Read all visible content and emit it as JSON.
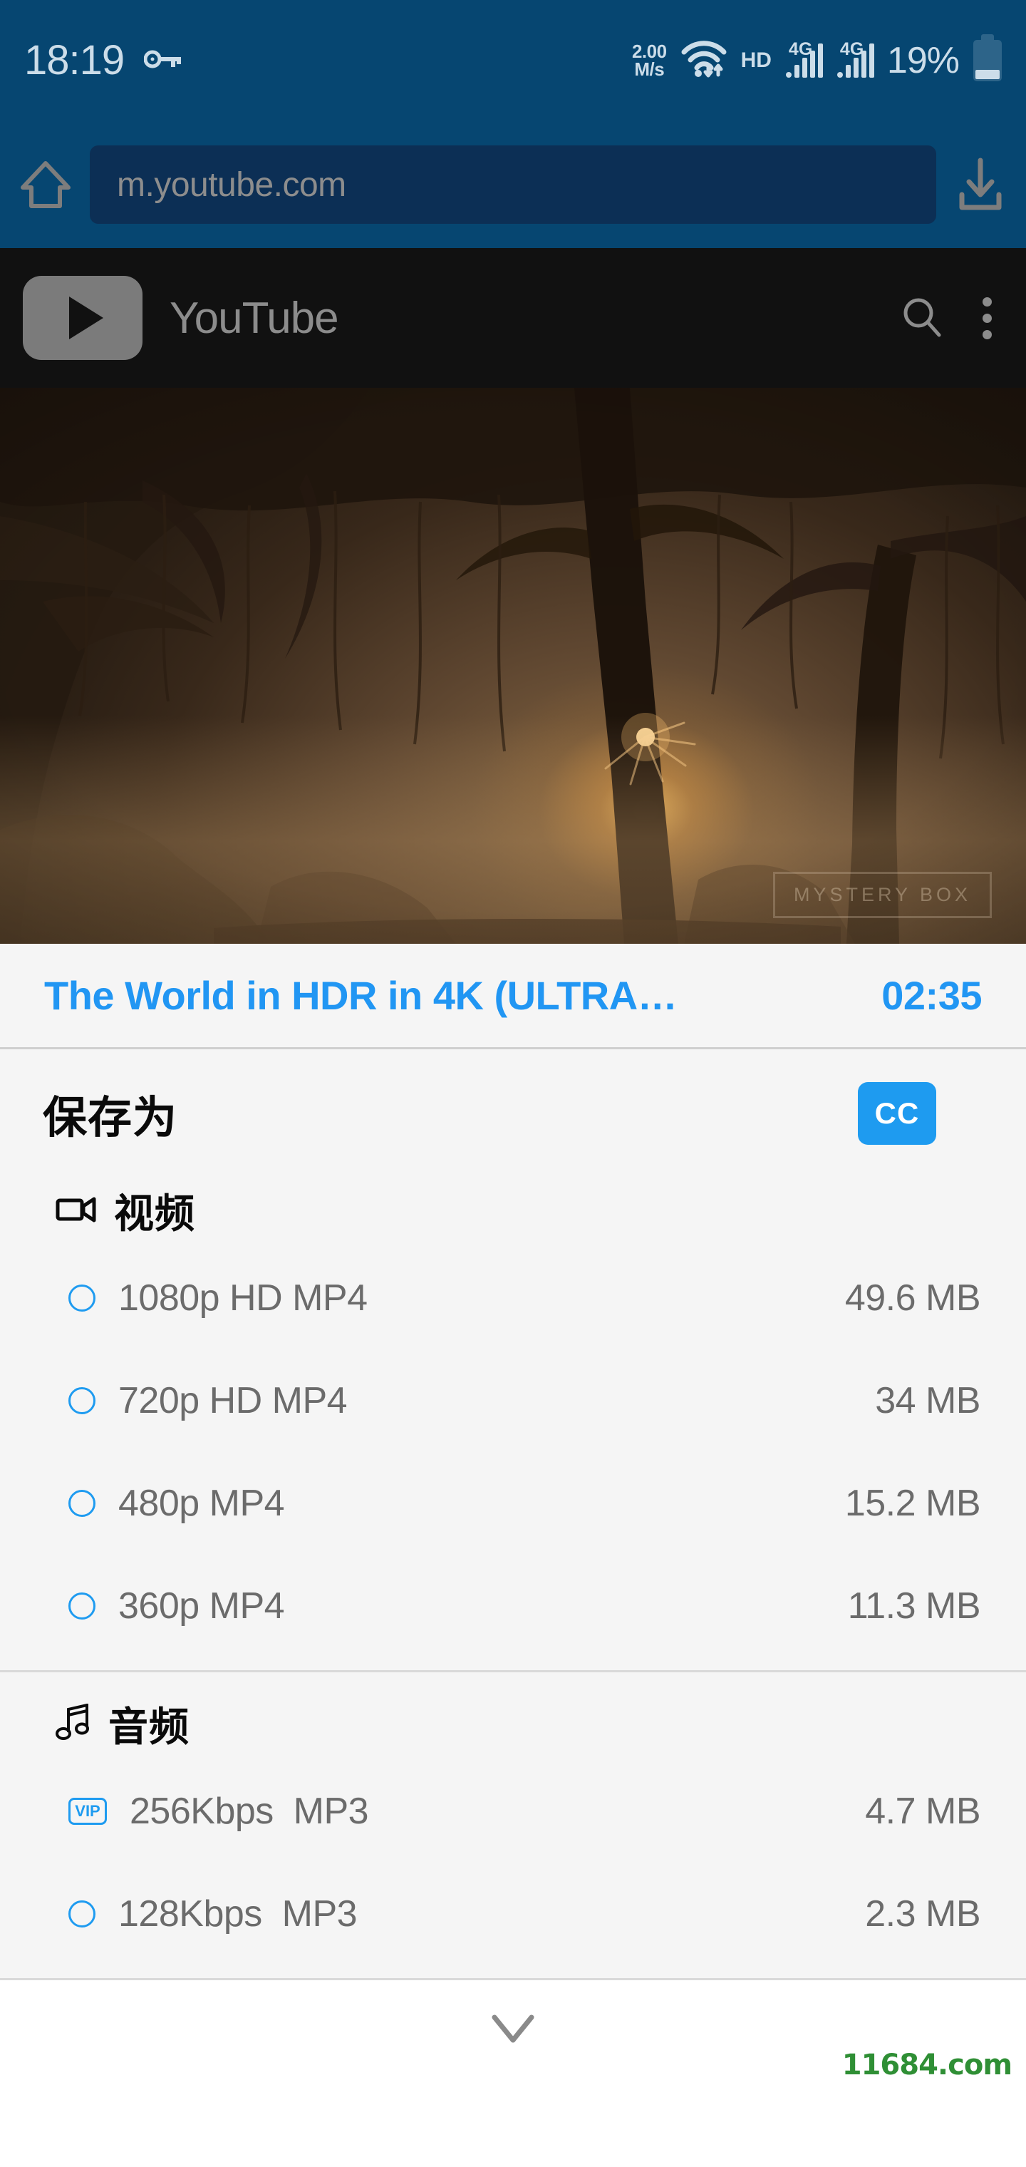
{
  "statusbar": {
    "time": "18:19",
    "key_icon": "key-icon",
    "network_speed_value": "2.00",
    "network_speed_unit": "M/s",
    "wifi_icon": "wifi-icon",
    "hd_label": "HD",
    "sim1_network": "4G",
    "sim2_network": "4G",
    "battery_percent": "19%",
    "battery_icon": "battery-low-icon"
  },
  "browser": {
    "home_icon": "home-icon",
    "url": "m.youtube.com",
    "download_icon": "download-icon"
  },
  "site_header": {
    "logo_icon": "youtube-play-icon",
    "brand": "YouTube",
    "search_icon": "search-icon",
    "menu_icon": "overflow-menu-icon"
  },
  "thumbnail": {
    "alt": "sunrise through willow trees",
    "watermark": "MYSTERY BOX"
  },
  "video": {
    "title": "The World in HDR in 4K (ULTRA…",
    "duration": "02:35"
  },
  "save_panel": {
    "heading": "保存为",
    "cc_badge": "CC",
    "sections": [
      {
        "icon": "video-camera-icon",
        "title": "视频",
        "options": [
          {
            "marker": "radio",
            "label": "1080p HD MP4",
            "size": "49.6 MB"
          },
          {
            "marker": "radio",
            "label": "720p HD MP4",
            "size": "34 MB"
          },
          {
            "marker": "radio",
            "label": "480p MP4",
            "size": "15.2 MB"
          },
          {
            "marker": "radio",
            "label": "360p MP4",
            "size": "11.3 MB"
          }
        ]
      },
      {
        "icon": "music-note-icon",
        "title": "音频",
        "options": [
          {
            "marker": "vip",
            "label": "256Kbps  MP3",
            "size": "4.7 MB",
            "badge": "VIP"
          },
          {
            "marker": "radio",
            "label": "128Kbps  MP3",
            "size": "2.3 MB"
          }
        ]
      }
    ]
  },
  "footer": {
    "expand_icon": "chevron-down-icon",
    "watermark": "11684.com"
  },
  "colors": {
    "status_bg": "#064671",
    "url_field_bg": "#0c2f55",
    "site_header_bg": "#111111",
    "accent_blue": "#2196f3",
    "badge_blue": "#1e9bf0",
    "panel_bg": "#f5f5f5",
    "watermark_green": "#2f8f35"
  }
}
